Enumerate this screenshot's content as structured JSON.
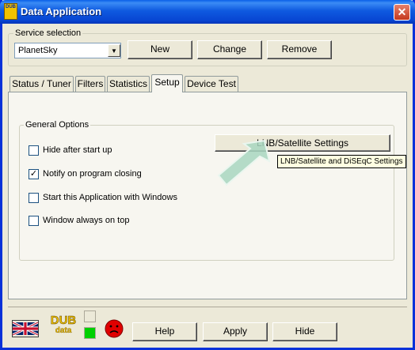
{
  "window": {
    "title": "Data Application",
    "icon_text": "DUB",
    "close_glyph": "✕"
  },
  "service": {
    "group_label": "Service selection",
    "selected": "PlanetSky",
    "new_label": "New",
    "change_label": "Change",
    "remove_label": "Remove"
  },
  "tabs": [
    {
      "label": "Status / Tuner"
    },
    {
      "label": "Filters"
    },
    {
      "label": "Statistics"
    },
    {
      "label": "Setup"
    },
    {
      "label": "Device Test"
    }
  ],
  "active_tab": "Setup",
  "general": {
    "group_label": "General Options",
    "options": [
      {
        "label": "Hide after start up",
        "checked": false
      },
      {
        "label": "Notify on program closing",
        "checked": true
      },
      {
        "label": "Start this Application with Windows",
        "checked": false
      },
      {
        "label": "Window always on top",
        "checked": false
      }
    ],
    "lnb_button_label": "LNB/Satellite Settings",
    "tooltip": "LNB/Satellite and DiSEqC Settings"
  },
  "footer": {
    "logo_line1": "DUB",
    "logo_line2": "data",
    "help_label": "Help",
    "apply_label": "Apply",
    "hide_label": "Hide"
  },
  "colors": {
    "titlebar": "#0a5fe8",
    "status_green": "#00d000",
    "status_red": "#e00000",
    "arrow": "#a8d6c0"
  }
}
